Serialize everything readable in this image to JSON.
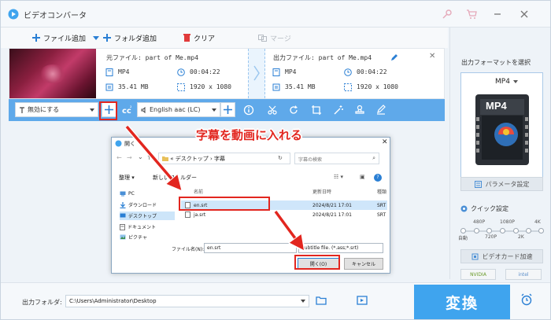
{
  "app": {
    "title": "ビデオコンバータ"
  },
  "toolbar": {
    "add_file": "ファイル追加",
    "add_folder": "フォルダ追加",
    "clear": "クリア",
    "merge": "マージ"
  },
  "file": {
    "source_label": "元ファイル: part of Me.mp4",
    "output_label": "出力ファイル: part of Me.mp4",
    "src_format": "MP4",
    "src_duration": "00:04:22",
    "src_size": "35.41 MB",
    "src_resolution": "1920 x 1080",
    "out_format": "MP4",
    "out_duration": "00:04:22",
    "out_size": "35.41 MB",
    "out_resolution": "1920 x 1080"
  },
  "editbar": {
    "subtitle_value": "無効にする",
    "audio_value": "English aac (LC)"
  },
  "right_panel": {
    "output_format_label": "出力フォーマットを選択",
    "format_value": "MP4",
    "format_badge": "MP4",
    "param_button": "パラメータ設定",
    "quick_label": "クイック設定",
    "quality_top": [
      "480P",
      "1080P",
      "4K"
    ],
    "quality_bottom": [
      "自動",
      "720P",
      "2K"
    ],
    "gpu_button": "ビデオカード加速",
    "badge_nvidia": "NVIDIA",
    "badge_intel": "intel"
  },
  "bottom": {
    "output_folder_label": "出力フォルダ:",
    "output_path": "C:\\Users\\Administrator\\Desktop",
    "convert_label": "変換"
  },
  "dialog": {
    "title": "開く",
    "breadcrumb": "« デスクトップ › 字幕",
    "search_placeholder": "字幕の検索",
    "organize": "整理 ▾",
    "new_folder": "新しいフォルダー",
    "nav": [
      "PC",
      "ダウンロード",
      "デスクトップ",
      "ドキュメント",
      "ピクチャ"
    ],
    "col_name": "名前",
    "col_date": "更新日時",
    "col_type": "種類",
    "files": [
      {
        "name": "en.srt",
        "date": "2024/8/21 17:01",
        "type": "SRT"
      },
      {
        "name": "ja.srt",
        "date": "2024/8/21 17:01",
        "type": "SRT"
      }
    ],
    "filename_label": "ファイル名(N):",
    "filename_value": "en.srt",
    "filter_value": "Subtitle file. (*.ass;*.srt)",
    "open_button": "開く(O)",
    "cancel_button": "キャンセル"
  },
  "annotation": {
    "callout": "字幕を動画に入れる"
  },
  "colors": {
    "accent": "#3fa4ee",
    "editbar": "#5fa9ea",
    "annotation": "#e2261f"
  }
}
